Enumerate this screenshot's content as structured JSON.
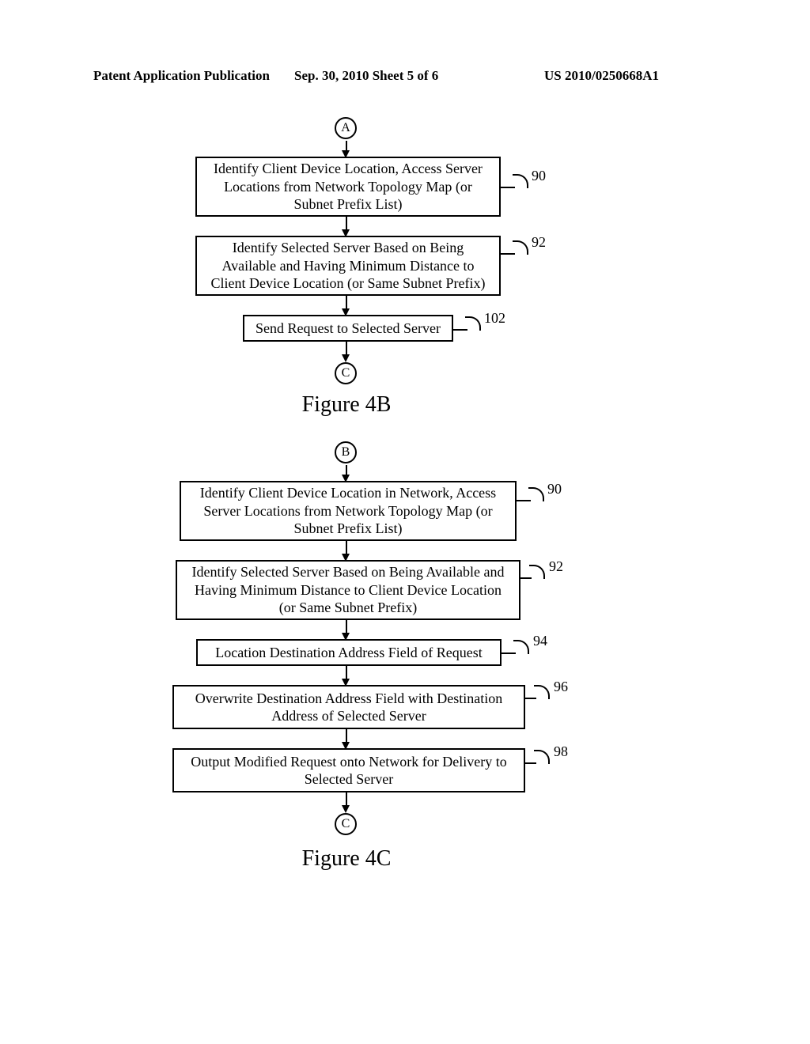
{
  "header": {
    "left": "Patent Application Publication",
    "mid": "Sep. 30, 2010   Sheet 5 of 6",
    "right": "US 2010/0250668A1"
  },
  "fig4b": {
    "connA": "A",
    "box90": "Identify Client Device Location, Access Server Locations from Network Topology Map (or Subnet Prefix List)",
    "ref90": "90",
    "box92": "Identify Selected Server Based on Being Available and Having Minimum Distance to Client Device Location (or Same Subnet Prefix)",
    "ref92": "92",
    "box102": "Send Request to Selected Server",
    "ref102": "102",
    "connC": "C",
    "caption": "Figure 4B"
  },
  "fig4c": {
    "connB": "B",
    "box90": "Identify Client Device Location in Network, Access Server Locations from Network Topology Map (or Subnet Prefix List)",
    "ref90": "90",
    "box92": "Identify Selected Server Based on Being Available and Having Minimum Distance to Client Device Location (or Same Subnet Prefix)",
    "ref92": "92",
    "box94": "Location Destination Address Field of Request",
    "ref94": "94",
    "box96": "Overwrite Destination Address Field with Destination Address of Selected Server",
    "ref96": "96",
    "box98": "Output Modified Request onto Network for Delivery to Selected Server",
    "ref98": "98",
    "connC": "C",
    "caption": "Figure 4C"
  }
}
